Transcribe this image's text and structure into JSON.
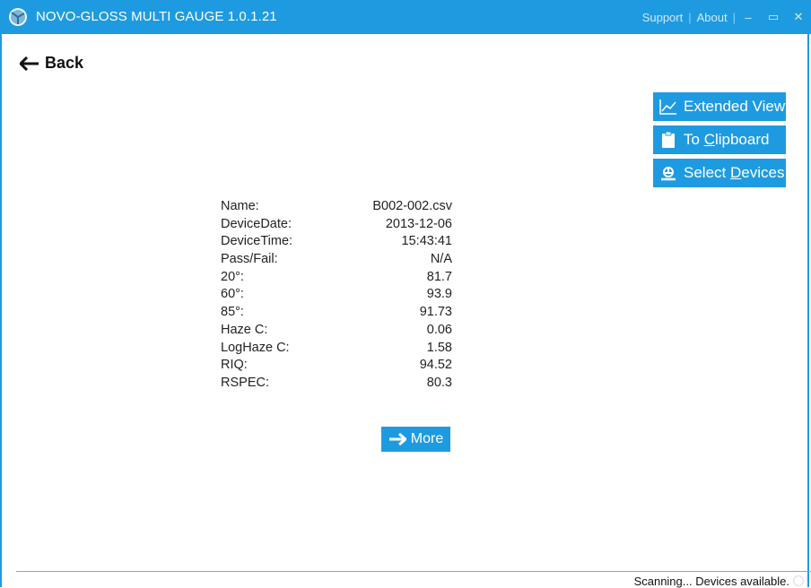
{
  "window": {
    "title": "NOVO-GLOSS MULTI GAUGE 1.0.1.21",
    "support": "Support",
    "about": "About",
    "separator": "|",
    "minimize": "‒",
    "maximize": "▭",
    "close": "✕"
  },
  "nav": {
    "back_label": "Back"
  },
  "actions": {
    "extended_view": "Extended View",
    "to_clipboard_prefix": "To ",
    "to_clipboard_accel": "C",
    "to_clipboard_rest": "lipboard",
    "select_devices_prefix": "Select ",
    "select_devices_accel": "D",
    "select_devices_rest": "evices"
  },
  "reading": {
    "rows": [
      {
        "label": "Name:",
        "value": "B002-002.csv"
      },
      {
        "label": "DeviceDate:",
        "value": "2013-12-06"
      },
      {
        "label": "DeviceTime:",
        "value": "15:43:41"
      },
      {
        "label": "Pass/Fail:",
        "value": "N/A"
      },
      {
        "label": "20°:",
        "value": "81.7"
      },
      {
        "label": "60°:",
        "value": "93.9"
      },
      {
        "label": "85°:",
        "value": "91.73"
      },
      {
        "label": "Haze C:",
        "value": "0.06"
      },
      {
        "label": "LogHaze C:",
        "value": "1.58"
      },
      {
        "label": "RIQ:",
        "value": "94.52"
      },
      {
        "label": "RSPEC:",
        "value": "80.3"
      }
    ],
    "more_label": "More"
  },
  "status": {
    "text": "Scanning... Devices available."
  },
  "colors": {
    "accent": "#1e9be0",
    "background": "#ffffff"
  },
  "icons": {
    "app": "app-logo-icon",
    "back": "arrow-left-icon",
    "extended_view": "line-chart-icon",
    "clipboard": "clipboard-icon",
    "select_devices": "device-connect-icon",
    "more": "arrow-right-icon",
    "spinner": "loading-spinner-icon"
  }
}
